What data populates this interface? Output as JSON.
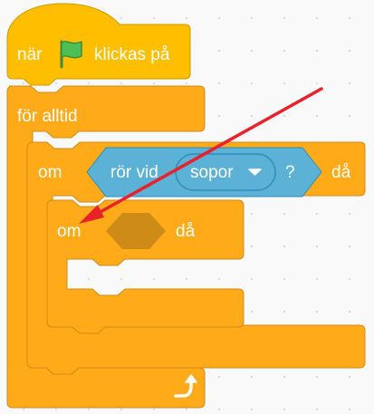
{
  "blocks": {
    "when_flag": {
      "prefix": "när",
      "suffix": "klickas på",
      "icon": "green-flag-icon"
    },
    "forever": {
      "label": "för alltid",
      "icon": "loop-arrow-icon"
    },
    "if_outer": {
      "if_label": "om",
      "then_label": "då"
    },
    "touching": {
      "label": "rör vid",
      "question": "?"
    },
    "touching_menu": {
      "value": "sopor",
      "icon": "dropdown-arrow-icon"
    },
    "if_inner": {
      "if_label": "om",
      "then_label": "då"
    }
  },
  "annotation": {
    "type": "red-arrow",
    "color": "#e8212b"
  },
  "colors": {
    "control": "#ffab19",
    "control_border": "#cf8b17",
    "events": "#ffbf00",
    "events_border": "#cc9900",
    "sensing": "#5cb1d6",
    "sensing_border": "#2e8eb8",
    "menu": "#5cb1d6",
    "empty_slot": "#cf8b17",
    "flag": "#4cbf56"
  }
}
